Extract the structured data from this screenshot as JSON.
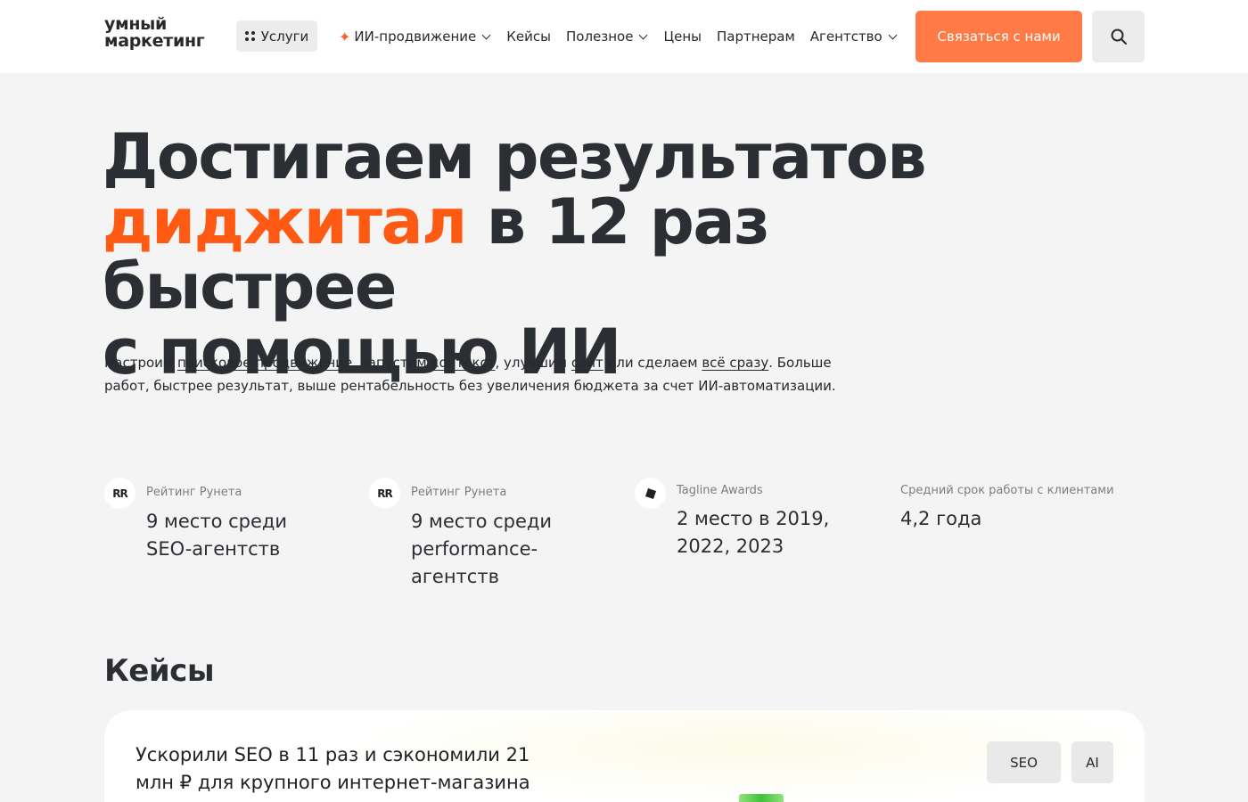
{
  "header": {
    "logo_line1": "умный",
    "logo_line2": "маркетинг",
    "services_label": "Услуги",
    "nav": [
      {
        "label": "ИИ-продвижение",
        "has_dropdown": true,
        "icon": "sparkle-icon"
      },
      {
        "label": "Кейсы",
        "has_dropdown": false
      },
      {
        "label": "Полезное",
        "has_dropdown": true
      },
      {
        "label": "Цены",
        "has_dropdown": false
      },
      {
        "label": "Партнерам",
        "has_dropdown": false
      },
      {
        "label": "Агентство",
        "has_dropdown": true
      }
    ],
    "cta_label": "Связаться с нами",
    "search_icon": "search-icon"
  },
  "hero": {
    "title_line1": "Достигаем результатов",
    "title_accent": "диджитал",
    "title_line2_rest": " в 12 раз быстрее",
    "title_line3": "с помощью ИИ",
    "desc_1": "Настроим ",
    "desc_link_seo": "поисковое продвижение",
    "desc_2": ", запустим ",
    "desc_link_context": "контекст",
    "desc_3": ", улучшим ",
    "desc_link_site": "сайт",
    "desc_4": " или сделаем ",
    "desc_link_all": "всё сразу",
    "desc_5": ". Больше работ, быстрее результат, выше рентабельность без увеличения бюджета за счет ИИ-автоматизации."
  },
  "stats": [
    {
      "icon_text": "RR",
      "label": "Рейтинг Рунета",
      "value": "9 место среди SEO-агентств"
    },
    {
      "icon_text": "RR",
      "label": "Рейтинг Рунета",
      "value": "9 место среди performance-агентств"
    },
    {
      "icon_text": "tagline-icon",
      "label": "Tagline Awards",
      "value": "2 место в 2019, 2022, 2023"
    },
    {
      "label": "Средний срок работы с клиентами",
      "value": "4,2 года"
    }
  ],
  "cases": {
    "title": "Кейсы",
    "first_case": {
      "title": "Ускорили SEO в 11 раз и сэкономили 21 млн ₽ для крупного интернет-магазина",
      "tags": [
        "SEO",
        "AI"
      ]
    }
  },
  "colors": {
    "accent": "#ff5a14",
    "cta": "#ff7a45",
    "background": "#f4f4f4",
    "text": "#27292c"
  }
}
